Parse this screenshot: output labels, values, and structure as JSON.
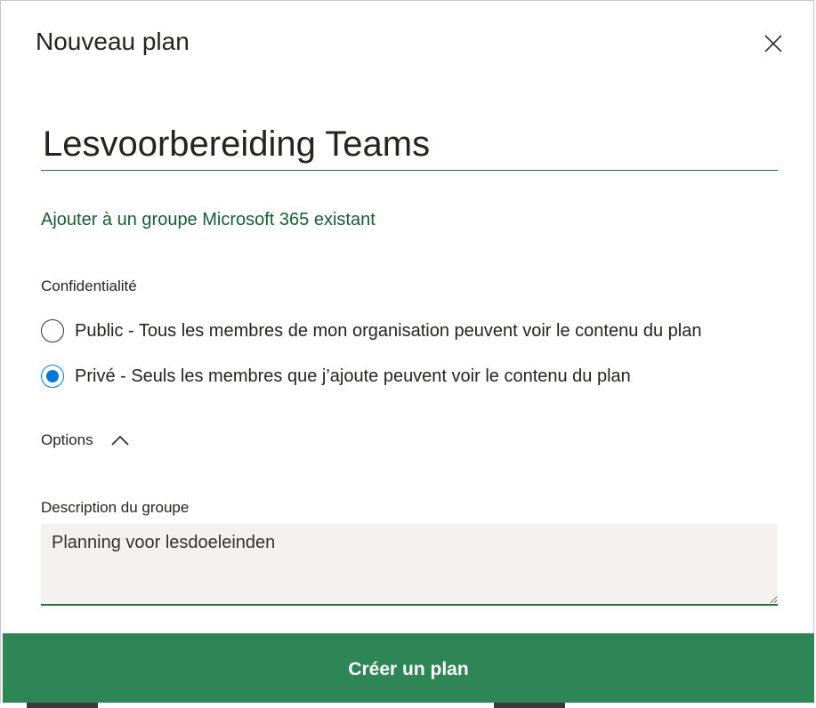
{
  "dialog": {
    "title": "Nouveau plan",
    "close_icon": "close-icon"
  },
  "plan": {
    "name_value": "Lesvoorbereiding Teams"
  },
  "group": {
    "link_label": "Ajouter à un groupe Microsoft 365 existant"
  },
  "privacy": {
    "label": "Confidentialité",
    "options": [
      {
        "label": "Public - Tous les membres de mon organisation peuvent voir le contenu du plan",
        "selected": false
      },
      {
        "label": "Privé - Seuls les membres que j’ajoute peuvent voir le contenu du plan",
        "selected": true
      }
    ]
  },
  "options": {
    "label": "Options",
    "expanded": true,
    "chevron_icon": "chevron-up-icon"
  },
  "description": {
    "label": "Description du groupe",
    "value": "Planning voor lesdoeleinden"
  },
  "footer": {
    "create_label": "Créer un plan"
  },
  "colors": {
    "accent_green": "#217346",
    "link_green": "#185c37",
    "footer_green": "#2e8555",
    "radio_blue": "#0078d4"
  }
}
